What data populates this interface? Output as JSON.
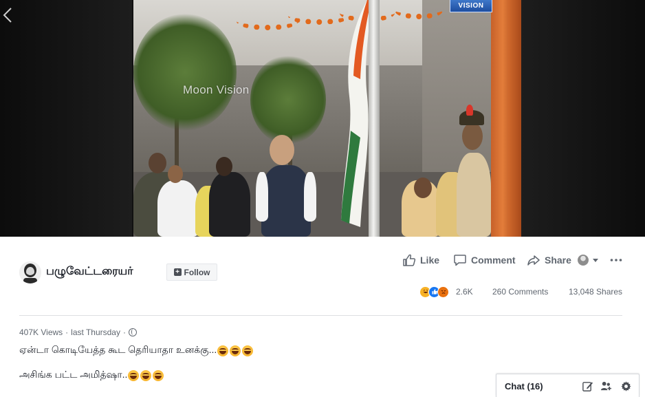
{
  "video": {
    "watermark": "Moon Vision",
    "channel_logo": "VISION"
  },
  "post": {
    "page_name": "பழுவேட்டரையர்",
    "follow_label": "Follow",
    "actions": {
      "like": "Like",
      "comment": "Comment",
      "share": "Share"
    },
    "reactions": {
      "types": [
        "haha",
        "like",
        "angry"
      ],
      "count": "2.6K"
    },
    "comments_count": "260 Comments",
    "shares_count": "13,048 Shares",
    "meta": {
      "views": "407K Views",
      "separator": "·",
      "time": "last Thursday",
      "privacy_icon": "globe-icon"
    },
    "caption": {
      "line1": "ஏன்டா கொடியேத்த கூட தெரியாதா உனக்கு...",
      "line2": "அசிங்க பட்ட அமித்ஷா.."
    }
  },
  "chat": {
    "label": "Chat (16)"
  },
  "colors": {
    "like_blue": "#1877f2",
    "haha_yellow": "#f7b125",
    "angry_orange": "#e9710f",
    "text_primary": "#1d2129",
    "text_secondary": "#606770"
  }
}
